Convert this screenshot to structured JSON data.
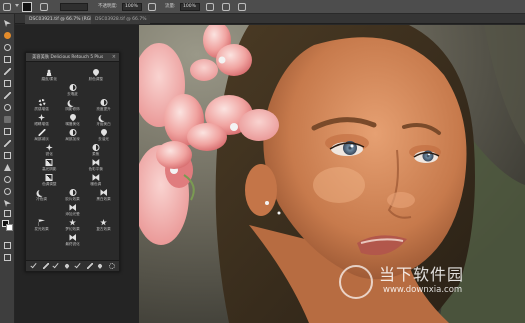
{
  "options_bar": {
    "opacity_label": "不透明度:",
    "opacity_value": "100%",
    "flow_label": "流量:",
    "flow_value": "100%"
  },
  "document_tabs": [
    {
      "label": "DSC03921.tif @ 66.7% (RGB/8)",
      "active": true
    },
    {
      "label": "DSC03928.tif @ 66.7%",
      "active": false
    }
  ],
  "panel": {
    "title": "美容美肤 Delicious Retouch 5 Plus",
    "close_symbol": "×",
    "rows": [
      [
        {
          "label": "磨皮/柔化",
          "icon": "person-icon"
        },
        {
          "label": "肤色调整",
          "icon": "drop-icon"
        }
      ],
      [
        {
          "label": "去瑕疵",
          "icon": "half-circle-icon"
        }
      ],
      [
        {
          "label": "质感增强",
          "icon": "gear-icon"
        },
        {
          "label": "阴影修饰",
          "icon": "moon-icon"
        },
        {
          "label": "亮度提升",
          "icon": "half-circle-icon"
        }
      ],
      [
        {
          "label": "眼睛增强",
          "icon": "sparkle-icon"
        },
        {
          "label": "嘴唇美化",
          "icon": "drop-icon"
        },
        {
          "label": "牙齿美白",
          "icon": "moon-icon"
        }
      ],
      [
        {
          "label": "局部减淡",
          "icon": "wand-icon"
        },
        {
          "label": "局部加深",
          "icon": "half-circle-icon"
        },
        {
          "label": "去油光",
          "icon": "drop-icon"
        }
      ],
      [
        {
          "label": "锐化",
          "icon": "sparkle-icon"
        },
        {
          "label": "柔焦",
          "icon": "half-circle-icon"
        }
      ],
      [
        {
          "label": "高光阴影",
          "icon": "square-icon"
        },
        {
          "label": "色彩平衡",
          "icon": "bowtie-icon"
        }
      ],
      [
        {
          "label": "色调调整",
          "icon": "square-icon"
        },
        {
          "label": "暖色调",
          "icon": "bowtie-icon"
        }
      ],
      [
        {
          "label": "冷色调",
          "icon": "moon-icon"
        },
        {
          "label": "胶片效果",
          "icon": "half-circle-icon"
        },
        {
          "label": "黑白效果",
          "icon": "bowtie-icon"
        }
      ],
      [
        {
          "label": "添加光晕",
          "icon": "bowtie-icon"
        }
      ],
      [
        {
          "label": "发光效果",
          "icon": "flag-icon"
        },
        {
          "label": "梦幻效果",
          "icon": "star-icon"
        },
        {
          "label": "复古效果",
          "icon": "star-icon"
        }
      ],
      [
        {
          "label": "最终锐化",
          "icon": "bowtie-icon"
        }
      ]
    ],
    "footer_icons": [
      "check-icon",
      "brush-icon",
      "check-icon",
      "dropper-icon",
      "check-icon",
      "brush-icon",
      "dropper-icon",
      "gear-icon"
    ]
  },
  "watermark": {
    "name": "当下软件园",
    "url": "www.downxia.com"
  },
  "colors": {
    "accent": "#e38b2a",
    "panel_bg": "#2a2a2a",
    "ui_bg": "#282828"
  }
}
